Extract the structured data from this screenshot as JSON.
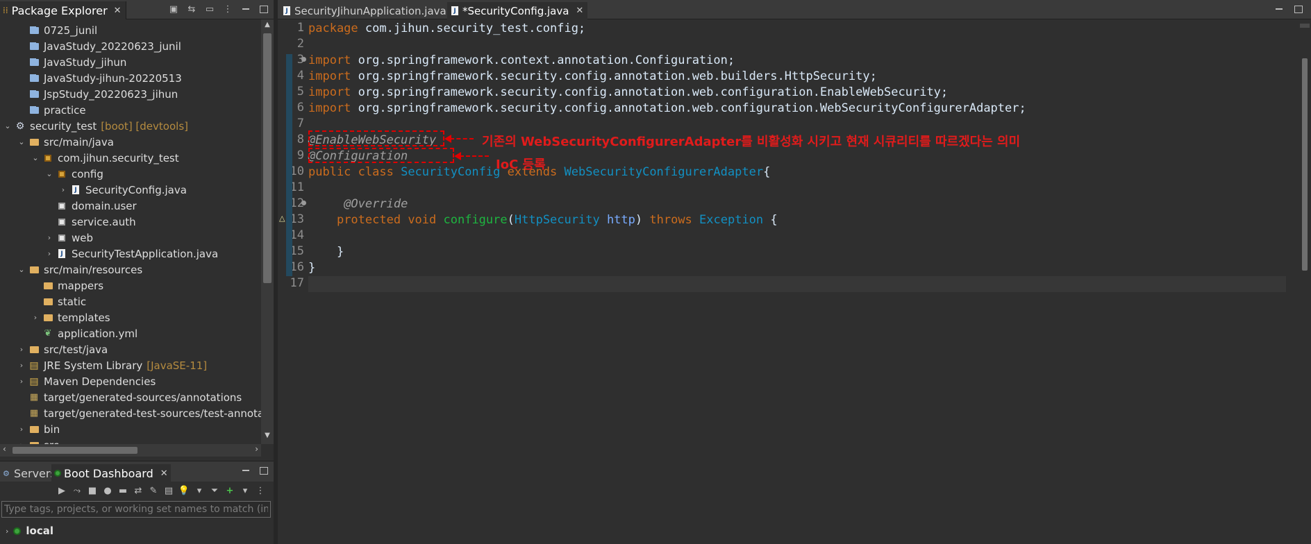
{
  "package_explorer": {
    "title": "Package Explorer",
    "tree": [
      {
        "label": "0725_junil",
        "icon": "folder-blue",
        "depth": 1,
        "arrow": ""
      },
      {
        "label": "JavaStudy_20220623_junil",
        "icon": "folder-blue",
        "depth": 1,
        "arrow": ""
      },
      {
        "label": "JavaStudy_jihun",
        "icon": "folder-blue",
        "depth": 1,
        "arrow": ""
      },
      {
        "label": "JavaStudy-jihun-20220513",
        "icon": "folder-blue",
        "depth": 1,
        "arrow": ""
      },
      {
        "label": "JspStudy_20220623_jihun",
        "icon": "folder-blue",
        "depth": 1,
        "arrow": ""
      },
      {
        "label": "practice",
        "icon": "folder-blue",
        "depth": 1,
        "arrow": ""
      },
      {
        "label": "security_test",
        "decoration": "[boot] [devtools]",
        "icon": "project",
        "depth": 0,
        "arrow": "expanded"
      },
      {
        "label": "src/main/java",
        "icon": "source-folder",
        "depth": 1,
        "arrow": "expanded"
      },
      {
        "label": "com.jihun.security_test",
        "icon": "package",
        "depth": 2,
        "arrow": "expanded"
      },
      {
        "label": "config",
        "icon": "package",
        "depth": 3,
        "arrow": "expanded"
      },
      {
        "label": "SecurityConfig.java",
        "icon": "java-file",
        "depth": 4,
        "arrow": "collapsed"
      },
      {
        "label": "domain.user",
        "icon": "package-empty",
        "depth": 3,
        "arrow": ""
      },
      {
        "label": "service.auth",
        "icon": "package-empty",
        "depth": 3,
        "arrow": ""
      },
      {
        "label": "web",
        "icon": "package-empty",
        "depth": 3,
        "arrow": "collapsed"
      },
      {
        "label": "SecurityTestApplication.java",
        "icon": "java-file",
        "depth": 3,
        "arrow": "collapsed"
      },
      {
        "label": "src/main/resources",
        "icon": "source-folder",
        "depth": 1,
        "arrow": "expanded"
      },
      {
        "label": "mappers",
        "icon": "folder",
        "depth": 2,
        "arrow": ""
      },
      {
        "label": "static",
        "icon": "folder",
        "depth": 2,
        "arrow": ""
      },
      {
        "label": "templates",
        "icon": "folder",
        "depth": 2,
        "arrow": "collapsed"
      },
      {
        "label": "application.yml",
        "icon": "yml-file",
        "depth": 2,
        "arrow": ""
      },
      {
        "label": "src/test/java",
        "icon": "source-folder",
        "depth": 1,
        "arrow": "collapsed"
      },
      {
        "label": "JRE System Library",
        "decoration": "[JavaSE-11]",
        "icon": "library",
        "depth": 1,
        "arrow": "collapsed"
      },
      {
        "label": "Maven Dependencies",
        "icon": "library",
        "depth": 1,
        "arrow": "collapsed"
      },
      {
        "label": "target/generated-sources/annotations",
        "icon": "generated-folder",
        "depth": 1,
        "arrow": ""
      },
      {
        "label": "target/generated-test-sources/test-annotation",
        "icon": "generated-folder",
        "depth": 1,
        "arrow": ""
      },
      {
        "label": "bin",
        "icon": "folder",
        "depth": 1,
        "arrow": "collapsed"
      },
      {
        "label": "src",
        "icon": "folder",
        "depth": 1,
        "arrow": "collapsed"
      }
    ]
  },
  "bottom_panel": {
    "tabs": [
      {
        "label": "Servers"
      },
      {
        "label": "Boot Dashboard"
      }
    ],
    "filter_placeholder": "Type tags, projects, or working set names to match (incl.",
    "local_label": "local"
  },
  "editor": {
    "tabs": [
      {
        "label": "SecurityJihunApplication.java",
        "active": false
      },
      {
        "label": "*SecurityConfig.java",
        "active": true
      }
    ],
    "line_numbers": [
      "1",
      "2",
      "3",
      "4",
      "5",
      "6",
      "7",
      "8",
      "9",
      "10",
      "11",
      "12",
      "13",
      "14",
      "15",
      "16",
      "17"
    ],
    "lines": [
      [
        {
          "t": "package ",
          "c": "kw"
        },
        {
          "t": "com.jihun.security_test.config;",
          "c": "plain"
        }
      ],
      [],
      [
        {
          "t": "import ",
          "c": "kw"
        },
        {
          "t": "org.springframework.context.annotation.Configuration;",
          "c": "plain"
        }
      ],
      [
        {
          "t": "import ",
          "c": "kw"
        },
        {
          "t": "org.springframework.security.config.annotation.web.builders.HttpSecurity;",
          "c": "plain"
        }
      ],
      [
        {
          "t": "import ",
          "c": "kw"
        },
        {
          "t": "org.springframework.security.config.annotation.web.configuration.EnableWebSecurity;",
          "c": "plain"
        }
      ],
      [
        {
          "t": "import ",
          "c": "kw"
        },
        {
          "t": "org.springframework.security.config.annotation.web.configuration.WebSecurityConfigurerAdapter;",
          "c": "plain"
        }
      ],
      [],
      [
        {
          "t": "@EnableWebSecurity",
          "c": "ann"
        }
      ],
      [
        {
          "t": "@Configuration",
          "c": "ann"
        }
      ],
      [
        {
          "t": "public ",
          "c": "kw"
        },
        {
          "t": "class ",
          "c": "kw"
        },
        {
          "t": "SecurityConfig ",
          "c": "type"
        },
        {
          "t": "extends ",
          "c": "kw"
        },
        {
          "t": "WebSecurityConfigurerAdapter",
          "c": "type"
        },
        {
          "t": "{",
          "c": "plain"
        }
      ],
      [],
      [
        {
          "t": "     ",
          "c": "plain"
        },
        {
          "t": "@Override",
          "c": "ann"
        }
      ],
      [
        {
          "t": "    ",
          "c": "plain"
        },
        {
          "t": "protected ",
          "c": "kw"
        },
        {
          "t": "void ",
          "c": "kw"
        },
        {
          "t": "configure",
          "c": "meth"
        },
        {
          "t": "(",
          "c": "plain"
        },
        {
          "t": "HttpSecurity ",
          "c": "type"
        },
        {
          "t": "http",
          "c": "param"
        },
        {
          "t": ") ",
          "c": "plain"
        },
        {
          "t": "throws ",
          "c": "kw"
        },
        {
          "t": "Exception ",
          "c": "type"
        },
        {
          "t": "{",
          "c": "plain"
        }
      ],
      [],
      [
        {
          "t": "    }",
          "c": "plain"
        }
      ],
      [
        {
          "t": "}",
          "c": "plain"
        }
      ],
      []
    ],
    "annotations": {
      "note1": "기존의 WebSecurityConfigurerAdapter를 비활성화 시키고 현재 시큐리티를 따르겠다는 의미",
      "note2": "IoC 등록"
    }
  },
  "colors": {
    "keyword": "#cc6c1d",
    "type": "#1290c3",
    "method": "#1eb540",
    "annotation": "#a0a0a0",
    "note_red": "#e11b1b"
  }
}
